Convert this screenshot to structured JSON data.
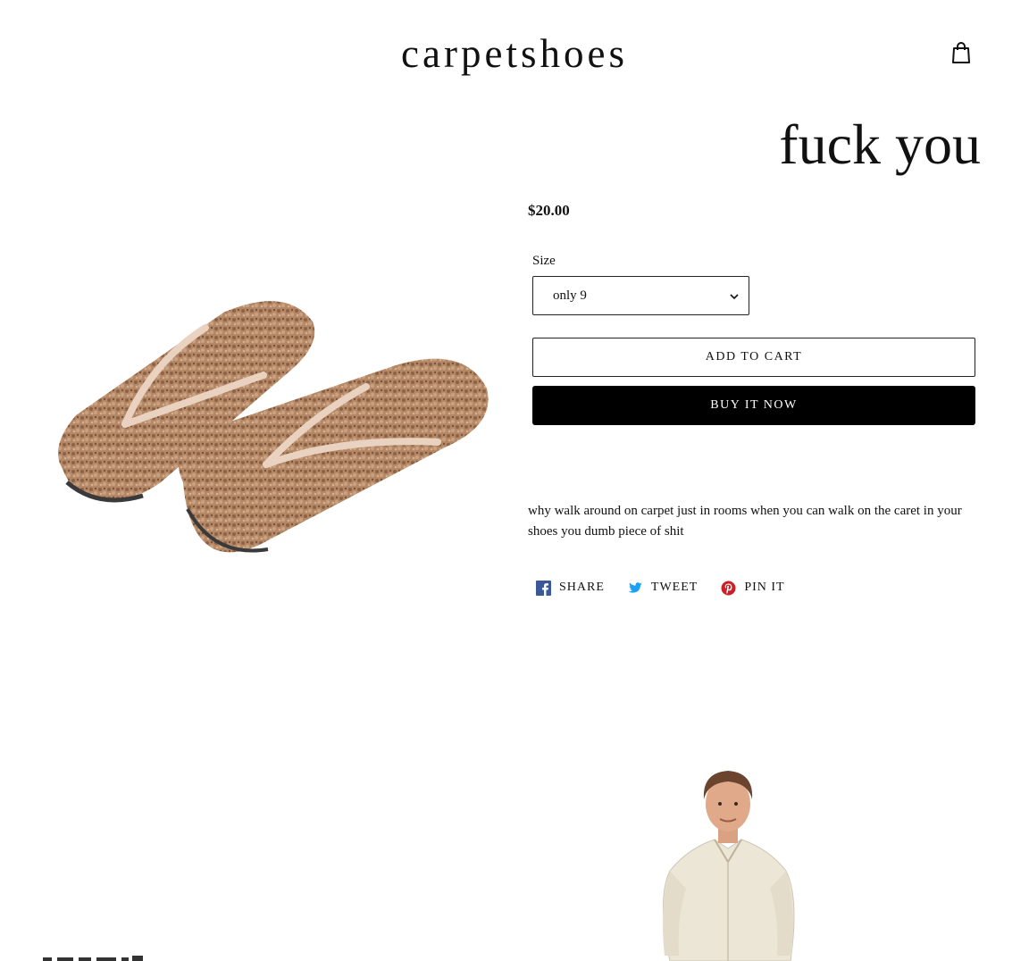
{
  "header": {
    "logo": "carpetshoes",
    "cart_icon": "shopping-bag-icon"
  },
  "product": {
    "title": "fuck you",
    "price": "$20.00",
    "size_label": "Size",
    "size_selected": "only 9",
    "add_to_cart": "ADD TO CART",
    "buy_now": "BUY IT NOW",
    "description": "why walk around on carpet just in rooms when you can walk on the caret in your shoes you dumb piece of shit"
  },
  "share": {
    "items": [
      {
        "label": "SHARE",
        "icon": "facebook-icon",
        "color": "#3b5998"
      },
      {
        "label": "TWEET",
        "icon": "twitter-icon",
        "color": "#1da1f2"
      },
      {
        "label": "PIN IT",
        "icon": "pinterest-icon",
        "color": "#cb2027"
      }
    ]
  },
  "colors": {
    "button_primary": "#000000",
    "carpet": "#b48866",
    "strap": "#e9d2c0"
  }
}
